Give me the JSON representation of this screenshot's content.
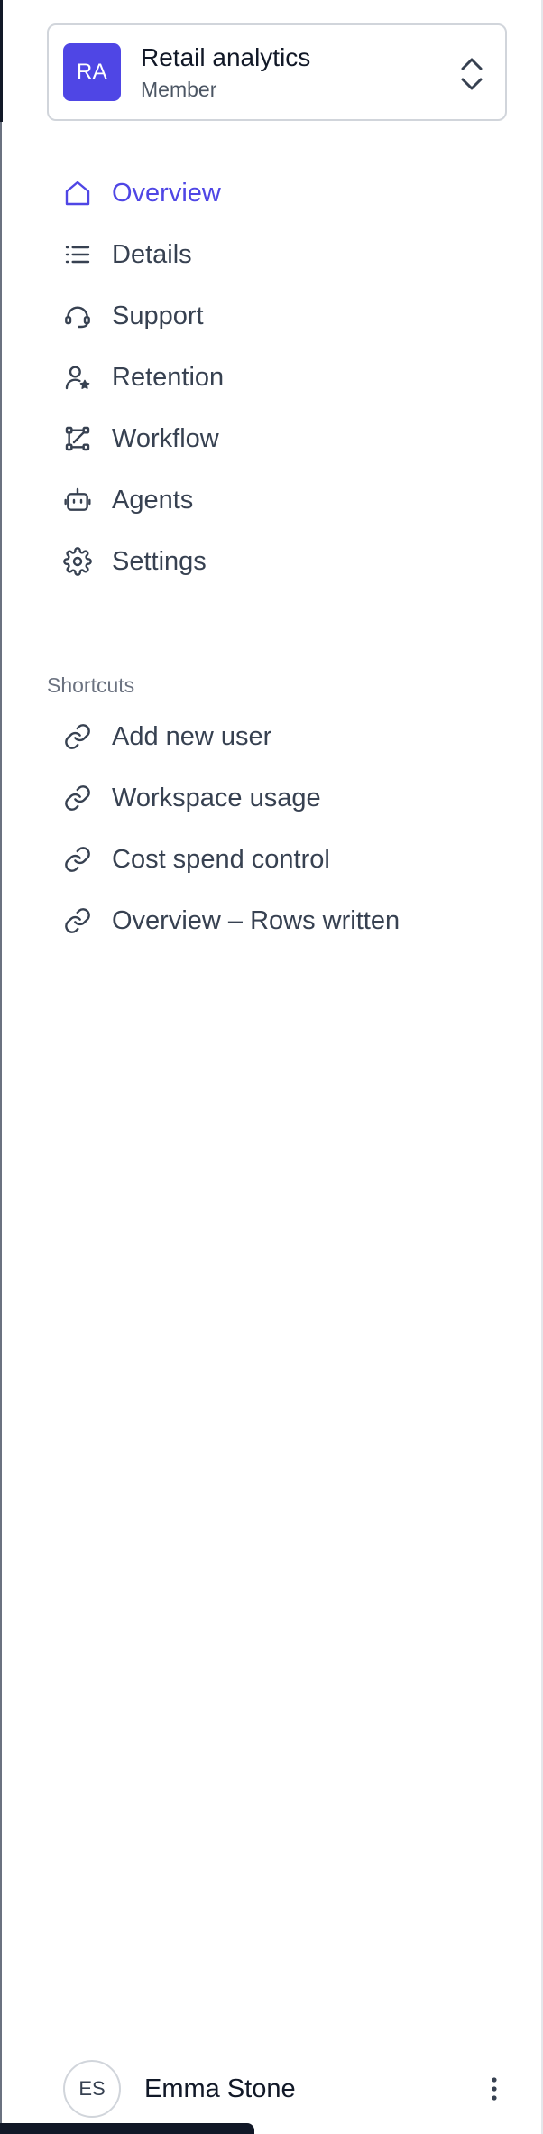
{
  "workspace": {
    "initials": "RA",
    "name": "Retail analytics",
    "role": "Member",
    "icon": "chevron-up-down-icon"
  },
  "nav": {
    "items": [
      {
        "label": "Overview",
        "icon": "home-icon",
        "active": true
      },
      {
        "label": "Details",
        "icon": "list-icon",
        "active": false
      },
      {
        "label": "Support",
        "icon": "headset-icon",
        "active": false
      },
      {
        "label": "Retention",
        "icon": "user-star-icon",
        "active": false
      },
      {
        "label": "Workflow",
        "icon": "workflow-icon",
        "active": false
      },
      {
        "label": "Agents",
        "icon": "robot-icon",
        "active": false
      },
      {
        "label": "Settings",
        "icon": "gear-icon",
        "active": false
      }
    ]
  },
  "shortcuts": {
    "title": "Shortcuts",
    "items": [
      {
        "label": "Add new user",
        "icon": "link-icon"
      },
      {
        "label": "Workspace usage",
        "icon": "link-icon"
      },
      {
        "label": "Cost spend control",
        "icon": "link-icon"
      },
      {
        "label": "Overview – Rows written",
        "icon": "link-icon"
      }
    ]
  },
  "user": {
    "initials": "ES",
    "name": "Emma Stone",
    "menu_icon": "more-vertical-icon"
  },
  "colors": {
    "accent": "#4f46e5",
    "text": "#374151",
    "muted": "#6b7280",
    "border": "#d1d5db"
  }
}
